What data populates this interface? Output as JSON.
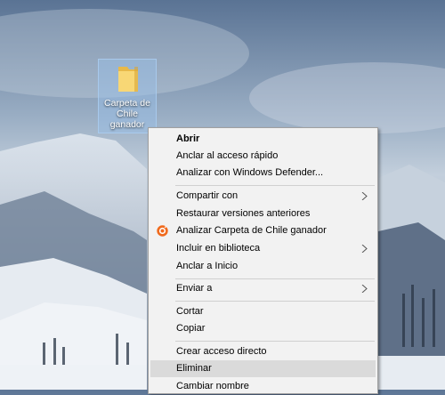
{
  "desktop": {
    "folder_label": "Carpeta de\nChile\nganador"
  },
  "context_menu": {
    "items": [
      {
        "label": "Abrir"
      },
      {
        "label": "Anclar al acceso rápido"
      },
      {
        "label": "Analizar con Windows Defender..."
      },
      {
        "label": "Compartir con"
      },
      {
        "label": "Restaurar versiones anteriores"
      },
      {
        "label": "Analizar Carpeta de Chile ganador"
      },
      {
        "label": "Incluir en biblioteca"
      },
      {
        "label": "Anclar a Inicio"
      },
      {
        "label": "Enviar a"
      },
      {
        "label": "Cortar"
      },
      {
        "label": "Copiar"
      },
      {
        "label": "Crear acceso directo"
      },
      {
        "label": "Eliminar"
      },
      {
        "label": "Cambiar nombre"
      }
    ]
  },
  "icons": {
    "folder": "folder-icon",
    "submenu": "chevron-right-icon",
    "antivirus": "avast-icon"
  },
  "colors": {
    "menu_bg": "#f2f2f2",
    "hover_bg": "#dadada",
    "selection_bg": "#99c1ec"
  }
}
